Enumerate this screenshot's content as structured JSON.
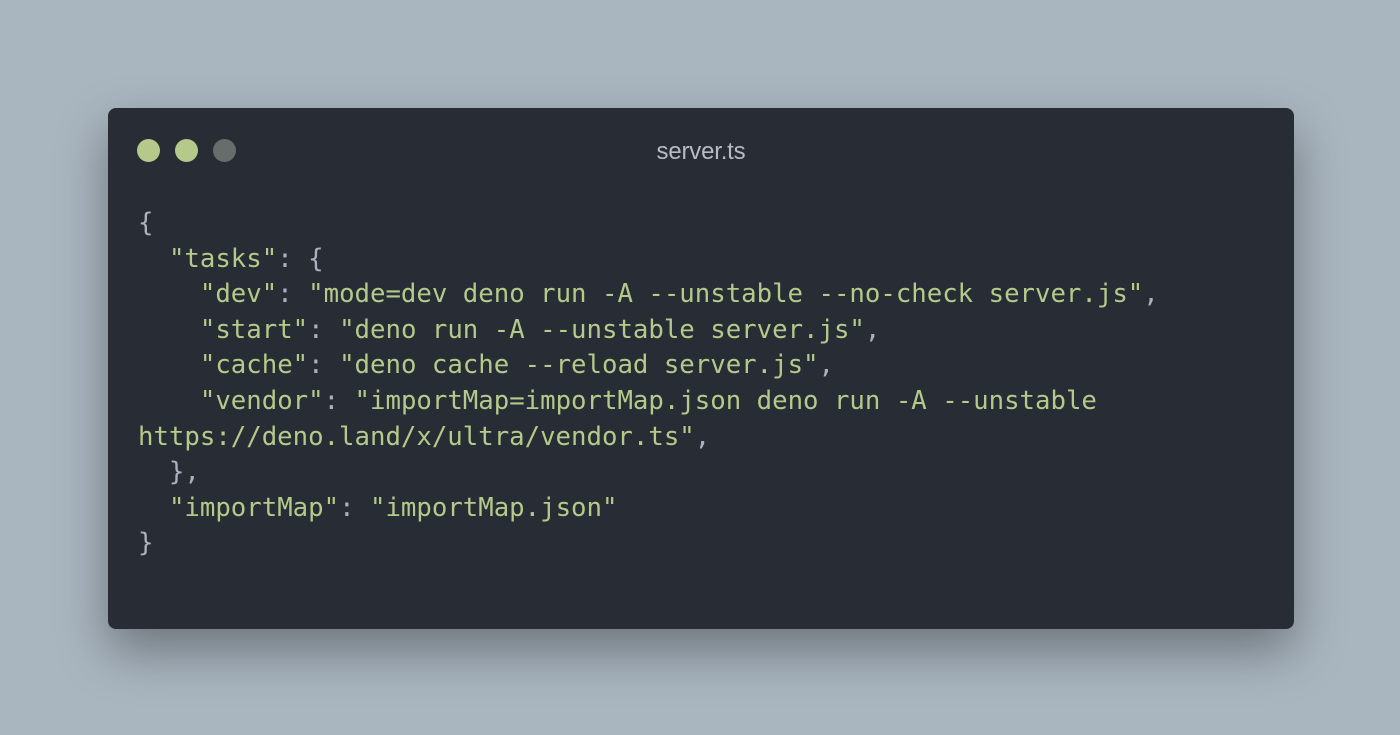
{
  "window": {
    "title": "server.ts",
    "controls": [
      {
        "name": "close",
        "color": "#b5c98a"
      },
      {
        "name": "minimize",
        "color": "#b5c98a"
      },
      {
        "name": "maximize",
        "color": "#676d6a"
      }
    ]
  },
  "colors": {
    "background": "#a9b5bf",
    "editor": "#282c34",
    "punctuation": "#abb2bf",
    "string": "#b5c98a",
    "title": "#b6bcc6"
  },
  "code": {
    "lines": [
      {
        "tokens": [
          {
            "t": "p",
            "v": "{"
          }
        ]
      },
      {
        "tokens": [
          {
            "t": "p",
            "v": "  "
          },
          {
            "t": "s",
            "v": "\"tasks\""
          },
          {
            "t": "p",
            "v": ": {"
          }
        ]
      },
      {
        "tokens": [
          {
            "t": "p",
            "v": "    "
          },
          {
            "t": "s",
            "v": "\"dev\""
          },
          {
            "t": "p",
            "v": ": "
          },
          {
            "t": "s",
            "v": "\"mode=dev deno run -A --unstable --no-check server.js\""
          },
          {
            "t": "p",
            "v": ","
          }
        ]
      },
      {
        "tokens": [
          {
            "t": "p",
            "v": "    "
          },
          {
            "t": "s",
            "v": "\"start\""
          },
          {
            "t": "p",
            "v": ": "
          },
          {
            "t": "s",
            "v": "\"deno run -A --unstable server.js\""
          },
          {
            "t": "p",
            "v": ","
          }
        ]
      },
      {
        "tokens": [
          {
            "t": "p",
            "v": "    "
          },
          {
            "t": "s",
            "v": "\"cache\""
          },
          {
            "t": "p",
            "v": ": "
          },
          {
            "t": "s",
            "v": "\"deno cache --reload server.js\""
          },
          {
            "t": "p",
            "v": ","
          }
        ]
      },
      {
        "tokens": [
          {
            "t": "p",
            "v": "    "
          },
          {
            "t": "s",
            "v": "\"vendor\""
          },
          {
            "t": "p",
            "v": ": "
          },
          {
            "t": "s",
            "v": "\"importMap=importMap.json deno run -A --unstable"
          }
        ]
      },
      {
        "tokens": [
          {
            "t": "s",
            "v": "https://deno.land/x/ultra/vendor.ts\""
          },
          {
            "t": "p",
            "v": ","
          }
        ]
      },
      {
        "tokens": [
          {
            "t": "p",
            "v": "  },"
          }
        ]
      },
      {
        "tokens": [
          {
            "t": "p",
            "v": "  "
          },
          {
            "t": "s",
            "v": "\"importMap\""
          },
          {
            "t": "p",
            "v": ": "
          },
          {
            "t": "s",
            "v": "\"importMap.json\""
          }
        ]
      },
      {
        "tokens": [
          {
            "t": "p",
            "v": "}"
          }
        ]
      }
    ]
  }
}
